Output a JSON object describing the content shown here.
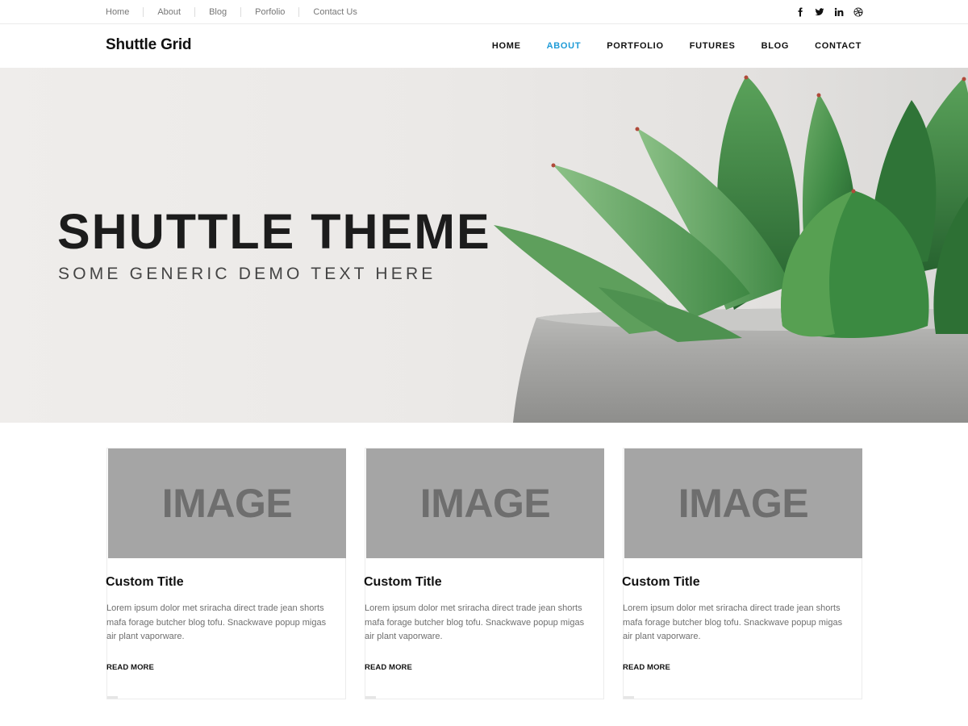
{
  "topbar": {
    "links": [
      "Home",
      "About",
      "Blog",
      "Porfolio",
      "Contact Us"
    ],
    "social": [
      "facebook-icon",
      "twitter-icon",
      "linkedin-icon",
      "dribbble-icon"
    ]
  },
  "header": {
    "logo": "Shuttle Grid",
    "nav": [
      {
        "label": "HOME",
        "active": false
      },
      {
        "label": "ABOUT",
        "active": true
      },
      {
        "label": "PORTFOLIO",
        "active": false
      },
      {
        "label": "FUTURES",
        "active": false
      },
      {
        "label": "BLOG",
        "active": false
      },
      {
        "label": "CONTACT",
        "active": false
      }
    ],
    "accent_color": "#1e9bd7"
  },
  "hero": {
    "title": "SHUTTLE THEME",
    "subtitle": "SOME GENERIC DEMO TEXT HERE",
    "image": "succulent-plant-in-concrete-pot"
  },
  "cards": [
    {
      "image_label": "IMAGE",
      "title": "Custom Title",
      "excerpt": "Lorem ipsum dolor met sriracha direct trade jean shorts mafa forage butcher blog tofu. Snackwave popup migas air plant vaporware.",
      "link": "READ MORE"
    },
    {
      "image_label": "IMAGE",
      "title": "Custom Title",
      "excerpt": "Lorem ipsum dolor met sriracha direct trade jean shorts mafa forage butcher blog tofu. Snackwave popup migas air plant vaporware.",
      "link": "READ MORE"
    },
    {
      "image_label": "IMAGE",
      "title": "Custom Title",
      "excerpt": "Lorem ipsum dolor met sriracha direct trade jean shorts mafa forage butcher blog tofu. Snackwave popup migas air plant vaporware.",
      "link": "READ MORE"
    }
  ]
}
